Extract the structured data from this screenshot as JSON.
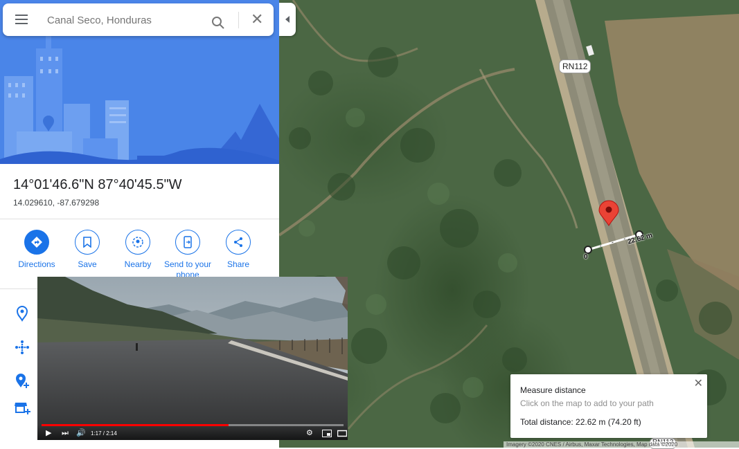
{
  "search": {
    "placeholder": "Canal Seco, Honduras",
    "menu_icon": "hamburger-menu-icon",
    "search_icon": "magnifier-icon",
    "clear_icon": "close-icon"
  },
  "place": {
    "coordinates_dms": "14°01'46.6\"N 87°40'45.5\"W",
    "coordinates_decimal": "14.029610, -87.679298"
  },
  "actions": [
    {
      "label": "Directions",
      "icon": "directions-icon"
    },
    {
      "label": "Save",
      "icon": "bookmark-icon"
    },
    {
      "label": "Nearby",
      "icon": "nearby-icon"
    },
    {
      "label": "Send to your phone",
      "icon": "send-to-phone-icon"
    },
    {
      "label": "Share",
      "icon": "share-icon"
    }
  ],
  "side_icons": [
    "location-pin-icon",
    "plus-code-icon",
    "add-place-icon",
    "add-business-icon"
  ],
  "map": {
    "road_label": "RN112",
    "road_label_bottom": "RN112",
    "measure_start_label": "0",
    "measure_end_label": "22.62 m",
    "attribution": "Imagery ©2020 CNES / Airbus, Maxar Technologies, Map data ©2020"
  },
  "measure": {
    "title": "Measure distance",
    "hint": "Click on the map to add to your path",
    "total": "Total distance: 22.62 m (74.20 ft)"
  },
  "video": {
    "time": "1:17 / 2:14",
    "progress": 0.62
  },
  "colors": {
    "accent": "#1a73e8",
    "hero_bg": "#4a85e8",
    "pin": "#ea4335"
  }
}
